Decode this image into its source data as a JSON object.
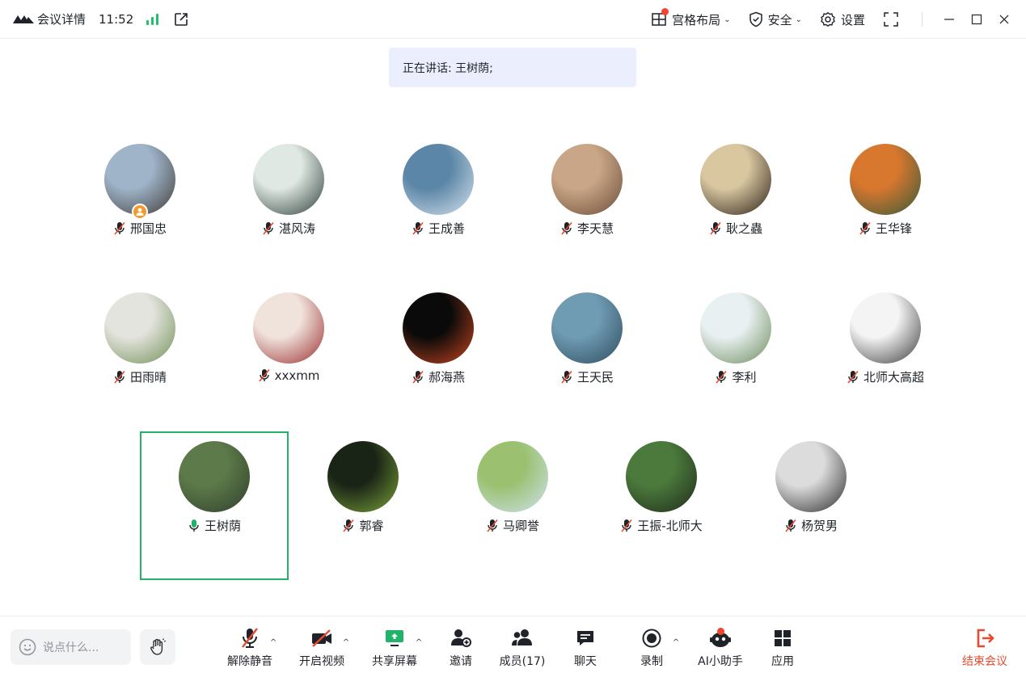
{
  "titlebar": {
    "title": "会议详情",
    "time": "11:52",
    "layout_label": "宫格布局",
    "security_label": "安全",
    "settings_label": "设置"
  },
  "speaking_banner": "正在讲话: 王树荫;",
  "participants": [
    {
      "name": "邢国忠",
      "mic": "muted",
      "host": true
    },
    {
      "name": "湛风涛",
      "mic": "muted"
    },
    {
      "name": "王成善",
      "mic": "muted"
    },
    {
      "name": "李天慧",
      "mic": "muted"
    },
    {
      "name": "耿之蟲",
      "mic": "muted"
    },
    {
      "name": "王华锋",
      "mic": "muted"
    },
    {
      "name": "田雨晴",
      "mic": "muted"
    },
    {
      "name": "xxxmm",
      "mic": "muted"
    },
    {
      "name": "郝海燕",
      "mic": "muted"
    },
    {
      "name": "王天民",
      "mic": "muted"
    },
    {
      "name": "李利",
      "mic": "muted"
    },
    {
      "name": "北师大高超",
      "mic": "muted"
    },
    {
      "name": "王树荫",
      "mic": "speaking",
      "active_speaker": true
    },
    {
      "name": "郭睿",
      "mic": "muted"
    },
    {
      "name": "马卿誉",
      "mic": "muted"
    },
    {
      "name": "王振-北师大",
      "mic": "muted"
    },
    {
      "name": "杨贺男",
      "mic": "muted"
    }
  ],
  "toolbar": {
    "chat_placeholder": "说点什么...",
    "unmute": "解除静音",
    "start_video": "开启视频",
    "share_screen": "共享屏幕",
    "invite": "邀请",
    "members": "成员(17)",
    "chat": "聊天",
    "record": "录制",
    "ai_assistant": "AI小助手",
    "apps": "应用",
    "end_meeting": "结束会议"
  },
  "colors": {
    "accent_green": "#21b368",
    "end_red": "#e8492f",
    "badge_red": "#f0462f",
    "banner_bg": "#eaeefd"
  }
}
